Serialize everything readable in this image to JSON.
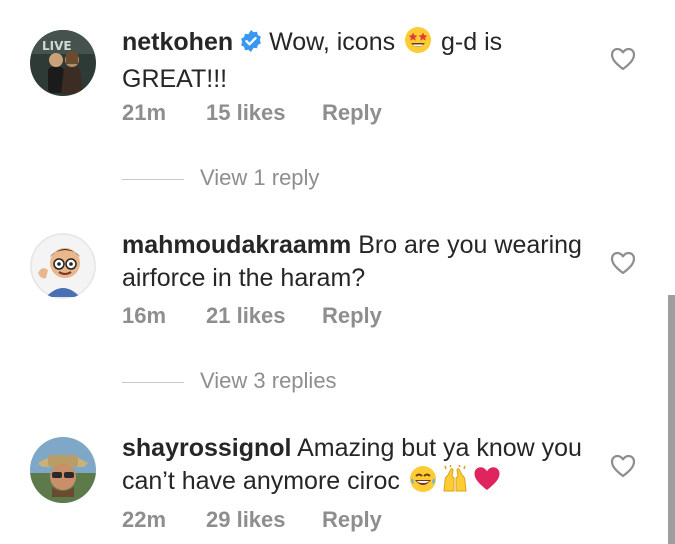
{
  "comments": [
    {
      "username": "netkohen",
      "verified": true,
      "text_before_emoji": "Wow, icons ",
      "text_after_emoji": " g-d is GREAT!!!",
      "time": "21m",
      "likes": "15 likes",
      "reply": "Reply",
      "view_replies": "View 1 reply"
    },
    {
      "username": "mahmoudakraamm",
      "verified": false,
      "text": "Bro are you wearing airforce in the haram?",
      "time": "16m",
      "likes": "21 likes",
      "reply": "Reply",
      "view_replies": "View 3 replies"
    },
    {
      "username": "shayrossignol",
      "verified": false,
      "text": "Amazing but ya know you can’t have anymore ciroc ",
      "time": "22m",
      "likes": "29 likes",
      "reply": "Reply"
    }
  ],
  "colors": {
    "text": "#262626",
    "meta": "#8e8e8e",
    "verified": "#3897f0",
    "emoji_yellow": "#ffcc33",
    "heart_red": "#e0245e"
  },
  "icons": [
    "verified-badge-icon",
    "star-struck-emoji-icon",
    "laughing-tears-emoji-icon",
    "raised-hands-emoji-icon",
    "red-heart-emoji-icon",
    "like-heart-icon"
  ]
}
